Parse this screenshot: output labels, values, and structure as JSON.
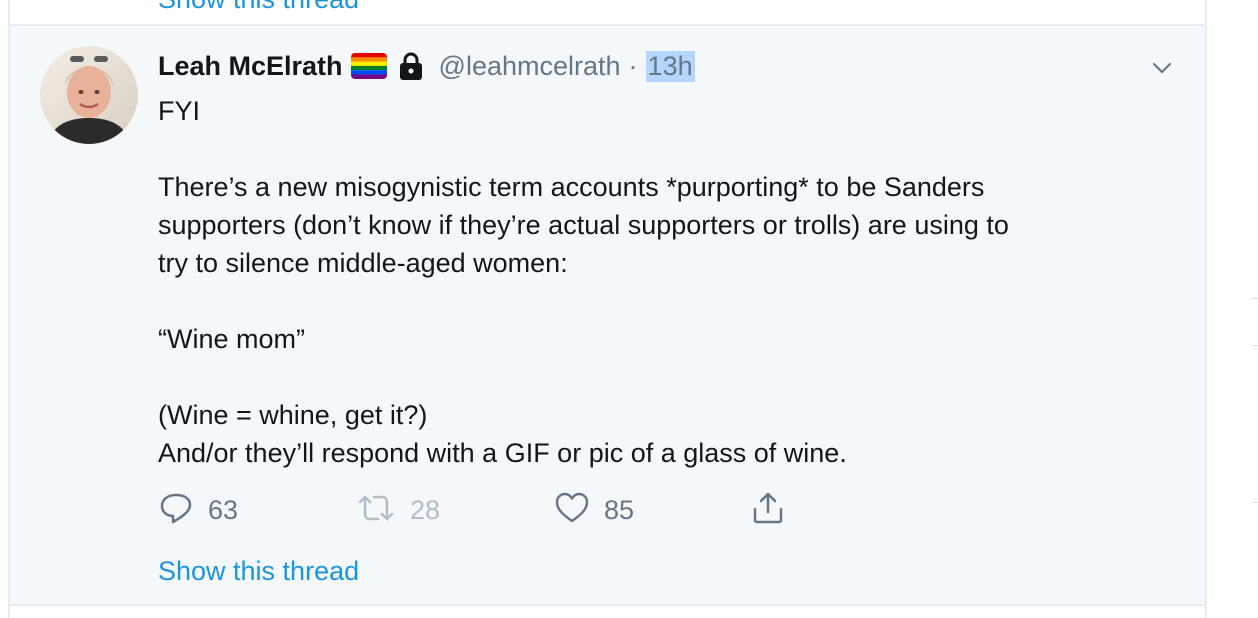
{
  "previous_tweet": {
    "show_thread_label": "Show this thread"
  },
  "tweet": {
    "author_name": "Leah McElrath",
    "handle": "@leahmcelrath",
    "separator": "·",
    "timestamp": "13h",
    "body_lines": [
      "FYI",
      "",
      "There’s a new misogynistic term accounts *purporting* to be Sanders",
      "supporters (don’t know if they’re actual supporters or trolls) are using to",
      "try to silence middle-aged women:",
      "",
      "“Wine mom”",
      "",
      "(Wine = whine, get it?)",
      "And/or they’ll respond with a GIF or pic of a glass of wine."
    ],
    "actions": {
      "reply": {
        "icon": "reply-icon",
        "count": "63"
      },
      "retweet": {
        "icon": "retweet-icon",
        "count": "28"
      },
      "like": {
        "icon": "heart-icon",
        "count": "85"
      },
      "share": {
        "icon": "share-icon"
      }
    },
    "show_thread_label": "Show this thread"
  },
  "colors": {
    "link": "#1b95e0",
    "muted": "#657786",
    "text": "#14171a",
    "highlight": "#b4d5fe",
    "tweet_bg": "#f5f8fa"
  }
}
